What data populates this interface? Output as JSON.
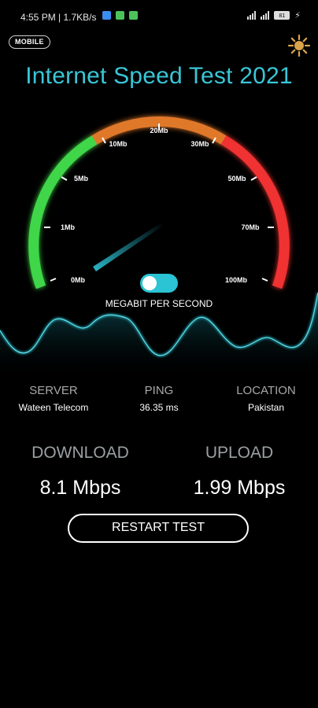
{
  "status_bar": {
    "time": "4:55 PM | 1.7KB/s",
    "battery": "81",
    "notif_colors": [
      "#3b8cf0",
      "#4cc35a",
      "#4cc35a"
    ]
  },
  "header": {
    "mode_badge": "MOBILE",
    "theme_icon": "sun-icon",
    "title": "Internet Speed Test 2021"
  },
  "gauge": {
    "ticks": [
      "0Mb",
      "1Mb",
      "5Mb",
      "10Mb",
      "20Mb",
      "30Mb",
      "50Mb",
      "70Mb",
      "100Mb"
    ],
    "unit": "MEGABIT PER SECOND",
    "toggle_on": true,
    "colors": {
      "low": "#3fd64a",
      "mid": "#e0782c",
      "high": "#f03030",
      "needle": "#2bb7c9"
    }
  },
  "info": {
    "server": {
      "label": "SERVER",
      "value": "Wateen Telecom"
    },
    "ping": {
      "label": "PING",
      "value": "36.35 ms"
    },
    "location": {
      "label": "LOCATION",
      "value": "Pakistan"
    }
  },
  "results": {
    "download": {
      "label": "DOWNLOAD",
      "value": "8.1 Mbps"
    },
    "upload": {
      "label": "UPLOAD",
      "value": "1.99 Mbps"
    }
  },
  "actions": {
    "restart_label": "RESTART TEST"
  }
}
